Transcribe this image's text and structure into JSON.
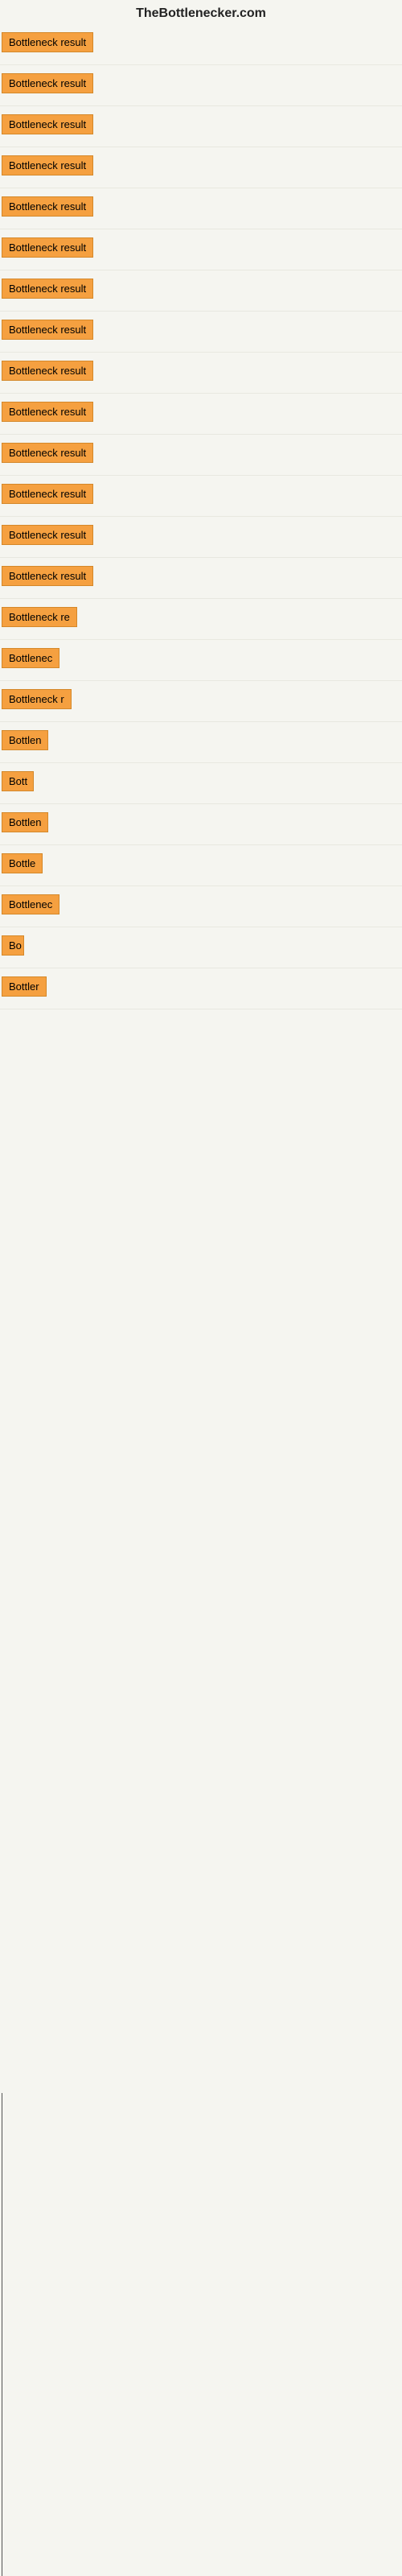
{
  "header": {
    "site_title": "TheBottlenecker.com"
  },
  "rows": [
    {
      "id": 1,
      "label": "Bottleneck result",
      "width": 130
    },
    {
      "id": 2,
      "label": "Bottleneck result",
      "width": 130
    },
    {
      "id": 3,
      "label": "Bottleneck result",
      "width": 130
    },
    {
      "id": 4,
      "label": "Bottleneck result",
      "width": 130
    },
    {
      "id": 5,
      "label": "Bottleneck result",
      "width": 130
    },
    {
      "id": 6,
      "label": "Bottleneck result",
      "width": 130
    },
    {
      "id": 7,
      "label": "Bottleneck result",
      "width": 130
    },
    {
      "id": 8,
      "label": "Bottleneck result",
      "width": 130
    },
    {
      "id": 9,
      "label": "Bottleneck result",
      "width": 130
    },
    {
      "id": 10,
      "label": "Bottleneck result",
      "width": 130
    },
    {
      "id": 11,
      "label": "Bottleneck result",
      "width": 130
    },
    {
      "id": 12,
      "label": "Bottleneck result",
      "width": 130
    },
    {
      "id": 13,
      "label": "Bottleneck result",
      "width": 130
    },
    {
      "id": 14,
      "label": "Bottleneck result",
      "width": 130
    },
    {
      "id": 15,
      "label": "Bottleneck re",
      "width": 100
    },
    {
      "id": 16,
      "label": "Bottlenec",
      "width": 78
    },
    {
      "id": 17,
      "label": "Bottleneck r",
      "width": 88
    },
    {
      "id": 18,
      "label": "Bottlen",
      "width": 64
    },
    {
      "id": 19,
      "label": "Bott",
      "width": 40
    },
    {
      "id": 20,
      "label": "Bottlen",
      "width": 64
    },
    {
      "id": 21,
      "label": "Bottle",
      "width": 52
    },
    {
      "id": 22,
      "label": "Bottlenec",
      "width": 78
    },
    {
      "id": 23,
      "label": "Bo",
      "width": 28
    },
    {
      "id": 24,
      "label": "Bottler",
      "width": 56
    }
  ]
}
